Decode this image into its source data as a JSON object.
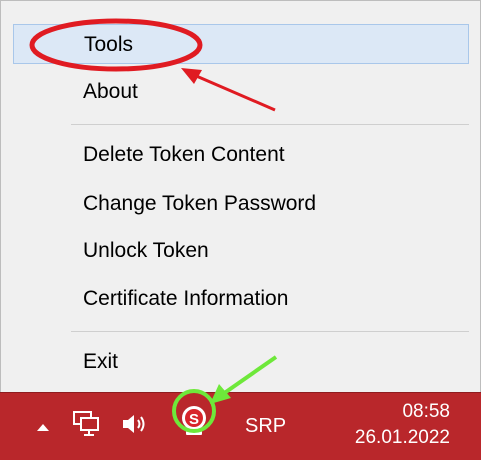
{
  "menu": {
    "items": [
      {
        "label": "Tools"
      },
      {
        "label": "About"
      },
      {
        "label": "Delete Token Content"
      },
      {
        "label": "Change Token Password"
      },
      {
        "label": "Unlock Token"
      },
      {
        "label": "Certificate Information"
      },
      {
        "label": "Exit"
      }
    ]
  },
  "taskbar": {
    "language": "SRP",
    "time": "08:58",
    "date": "26.01.2022",
    "icons": [
      "show-hidden-icons-arrow",
      "network-icon",
      "volume-icon",
      "token-tray-icon"
    ]
  },
  "colors": {
    "taskbar_bg": "#b9272b",
    "menu_bg": "#f0f0f0",
    "highlight_bg": "#dce8f6",
    "annotation_red": "#e01b22",
    "annotation_green": "#6ee83a"
  }
}
